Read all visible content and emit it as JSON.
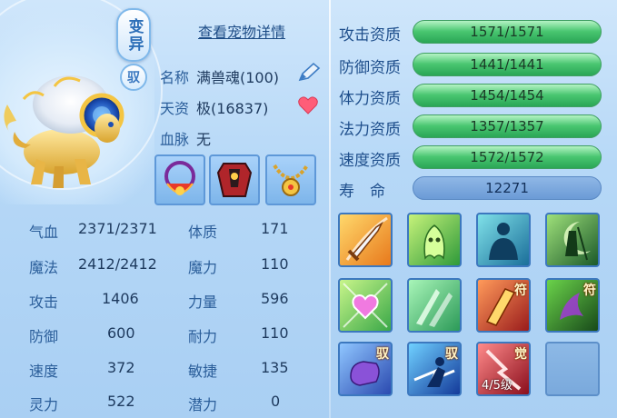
{
  "header": {
    "bianyi_badge": "变异",
    "yu_badge": "驭",
    "detail_link": "查看宠物详情"
  },
  "info": {
    "name_label": "名称",
    "name_value": "满兽魂(100)",
    "talent_label": "天资",
    "talent_value": "极(16837)",
    "bloodline_label": "血脉",
    "bloodline_value": "无"
  },
  "equipment": [
    {
      "icon": "necklace-red-icon"
    },
    {
      "icon": "armor-red-icon"
    },
    {
      "icon": "necklace-gold-icon"
    }
  ],
  "stats": {
    "hp_label": "气血",
    "hp_value": "2371/2371",
    "mp_label": "魔法",
    "mp_value": "2412/2412",
    "atk_label": "攻击",
    "atk_value": "1406",
    "def_label": "防御",
    "def_value": "600",
    "spd_label": "速度",
    "spd_value": "372",
    "sp_label": "灵力",
    "sp_value": "522",
    "con_label": "体质",
    "con_value": "171",
    "mag_label": "魔力",
    "mag_value": "110",
    "str_label": "力量",
    "str_value": "596",
    "end_label": "耐力",
    "end_value": "110",
    "agi_label": "敏捷",
    "agi_value": "135",
    "pot_label": "潜力",
    "pot_value": "0"
  },
  "aptitudes": [
    {
      "label": "攻击资质",
      "value": "1571/1571"
    },
    {
      "label": "防御资质",
      "value": "1441/1441"
    },
    {
      "label": "体力资质",
      "value": "1454/1454"
    },
    {
      "label": "法力资质",
      "value": "1357/1357"
    },
    {
      "label": "速度资质",
      "value": "1572/1572"
    }
  ],
  "lifespan": {
    "label": "寿　命",
    "value": "12271"
  },
  "skills": {
    "tags": {
      "fu": "符",
      "yu": "驭",
      "jue": "觉"
    },
    "level_text": "4/5级"
  },
  "colors": {
    "bar_green": "#49c670",
    "bar_blue": "#6b9bd6",
    "label_blue": "#2b5e9a"
  }
}
